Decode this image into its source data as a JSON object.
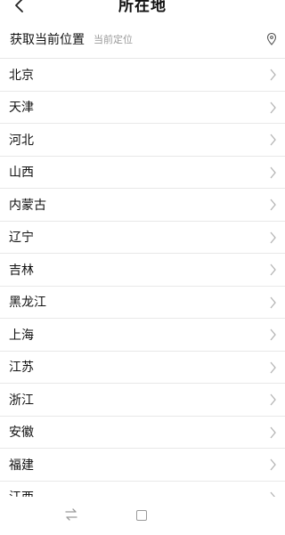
{
  "header": {
    "title": "所在地",
    "back_icon": "back-arrow-icon"
  },
  "location": {
    "title": "获取当前位置",
    "subtitle": "当前定位",
    "icon": "location-pin-icon"
  },
  "provinces": [
    "北京",
    "天津",
    "河北",
    "山西",
    "内蒙古",
    "辽宁",
    "吉林",
    "黑龙江",
    "上海",
    "江苏",
    "浙江",
    "安徽",
    "福建",
    "江西"
  ],
  "bottom_nav": {
    "left_icon": "switch-icon",
    "right_icon": "square-icon"
  }
}
